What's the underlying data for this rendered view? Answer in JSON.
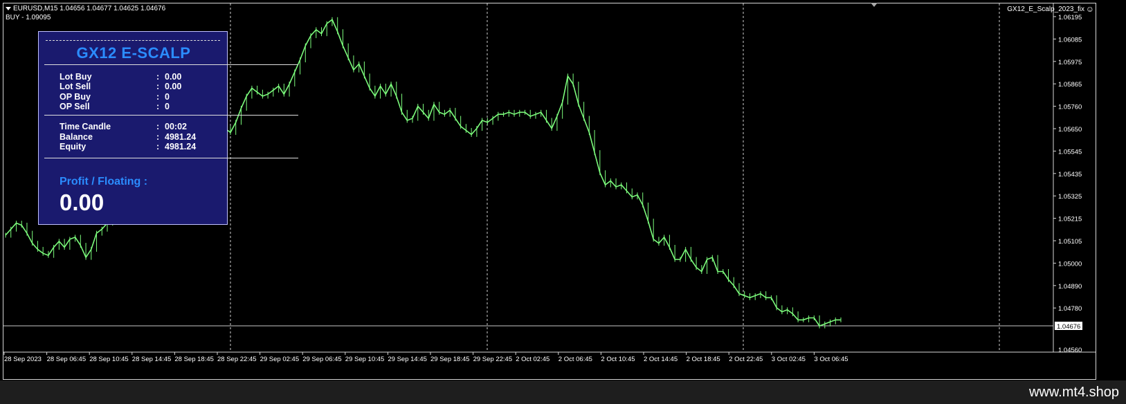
{
  "symbol_info": {
    "line1": "EURUSD,M15  1.04656 1.04677 1.04625 1.04676",
    "line2": "BUY - 1.09095"
  },
  "ea_name": "GX12_E_Scalp_2023_fix",
  "ea_icon": "smiley-icon",
  "colors": {
    "candle": "#7cfc7c",
    "panel_bg": "#1a1a6e",
    "accent": "#2b8cff",
    "background": "#000000"
  },
  "panel": {
    "title": "GX12 E-SCALP",
    "rows1": [
      {
        "label": "Lot Buy",
        "sep": ":",
        "value": "0.00"
      },
      {
        "label": "Lot Sell",
        "sep": ":",
        "value": "0.00"
      },
      {
        "label": "OP Buy",
        "sep": ":",
        "value": "0"
      },
      {
        "label": "OP Sell",
        "sep": ":",
        "value": "0"
      }
    ],
    "rows2": [
      {
        "label": "Time Candle",
        "sep": ":",
        "value": "00:02"
      },
      {
        "label": "Balance",
        "sep": ":",
        "value": "4981.24"
      },
      {
        "label": "Equity",
        "sep": ":",
        "value": "4981.24"
      }
    ],
    "profit_label": "Profit / Floating  :",
    "profit_value": "0.00"
  },
  "price_axis": [
    "1.06195",
    "1.06085",
    "1.05975",
    "1.05865",
    "1.05760",
    "1.05650",
    "1.05545",
    "1.05435",
    "1.05325",
    "1.05215",
    "1.05105",
    "1.05000",
    "1.04890",
    "1.04780"
  ],
  "price_axis_bottom": "1.04560",
  "current_price": "1.04676",
  "time_axis": [
    "28 Sep 2023",
    "28 Sep 06:45",
    "28 Sep 10:45",
    "28 Sep 14:45",
    "28 Sep 18:45",
    "28 Sep 22:45",
    "29 Sep 02:45",
    "29 Sep 06:45",
    "29 Sep 10:45",
    "29 Sep 14:45",
    "29 Sep 18:45",
    "29 Sep 22:45",
    "2 Oct 02:45",
    "2 Oct 06:45",
    "2 Oct 10:45",
    "2 Oct 14:45",
    "2 Oct 18:45",
    "2 Oct 22:45",
    "3 Oct 02:45",
    "3 Oct 06:45"
  ],
  "chart_data": {
    "type": "line",
    "symbol": "EURUSD",
    "timeframe": "M15",
    "ylim": [
      1.0451,
      1.0624
    ],
    "series": [
      {
        "name": "EURUSD",
        "values": [
          1.0509,
          1.0512,
          1.0515,
          1.0514,
          1.051,
          1.0505,
          1.0502,
          1.05,
          1.0499,
          1.0503,
          1.0506,
          1.0503,
          1.0507,
          1.0508,
          1.0504,
          1.0498,
          1.0502,
          1.051,
          1.0512,
          1.0515,
          1.0518,
          1.0522,
          1.0528,
          1.0533,
          1.0538,
          1.0542,
          1.0545,
          1.055,
          1.0555,
          1.0554,
          1.0552,
          1.0556,
          1.056,
          1.0562,
          1.0565,
          1.0566,
          1.0563,
          1.0562,
          1.0564,
          1.0566,
          1.0564,
          1.0562,
          1.056,
          1.0565,
          1.0572,
          1.0578,
          1.0582,
          1.058,
          1.0578,
          1.0579,
          1.0581,
          1.0583,
          1.0579,
          1.0584,
          1.059,
          1.0596,
          1.0603,
          1.0608,
          1.0611,
          1.0609,
          1.0614,
          1.0616,
          1.061,
          1.0603,
          1.0597,
          1.0591,
          1.0594,
          1.0588,
          1.0582,
          1.0578,
          1.0583,
          1.0579,
          1.0584,
          1.0578,
          1.057,
          1.0566,
          1.0567,
          1.0573,
          1.057,
          1.0567,
          1.0574,
          1.057,
          1.0569,
          1.0571,
          1.0567,
          1.0563,
          1.0561,
          1.0559,
          1.0562,
          1.0566,
          1.0565,
          1.0567,
          1.0569,
          1.0569,
          1.057,
          1.0569,
          1.057,
          1.057,
          1.0568,
          1.0569,
          1.057,
          1.0566,
          1.0562,
          1.0568,
          1.0575,
          1.0588,
          1.0584,
          1.0574,
          1.0567,
          1.056,
          1.055,
          1.054,
          1.0534,
          1.0536,
          1.0533,
          1.0534,
          1.0531,
          1.0528,
          1.0529,
          1.0524,
          1.0516,
          1.0507,
          1.0505,
          1.0508,
          1.0503,
          1.0497,
          1.0497,
          1.0502,
          1.0497,
          1.0493,
          1.0491,
          1.0497,
          1.0498,
          1.0491,
          1.0491,
          1.0487,
          1.0484,
          1.048,
          1.0479,
          1.0478,
          1.0479,
          1.048,
          1.0478,
          1.0478,
          1.0473,
          1.0471,
          1.0472,
          1.047,
          1.0467,
          1.0467,
          1.0468,
          1.0468,
          1.0464,
          1.0465,
          1.0466,
          1.0467,
          1.0467
        ]
      }
    ]
  },
  "watermark": "www.mt4.shop"
}
